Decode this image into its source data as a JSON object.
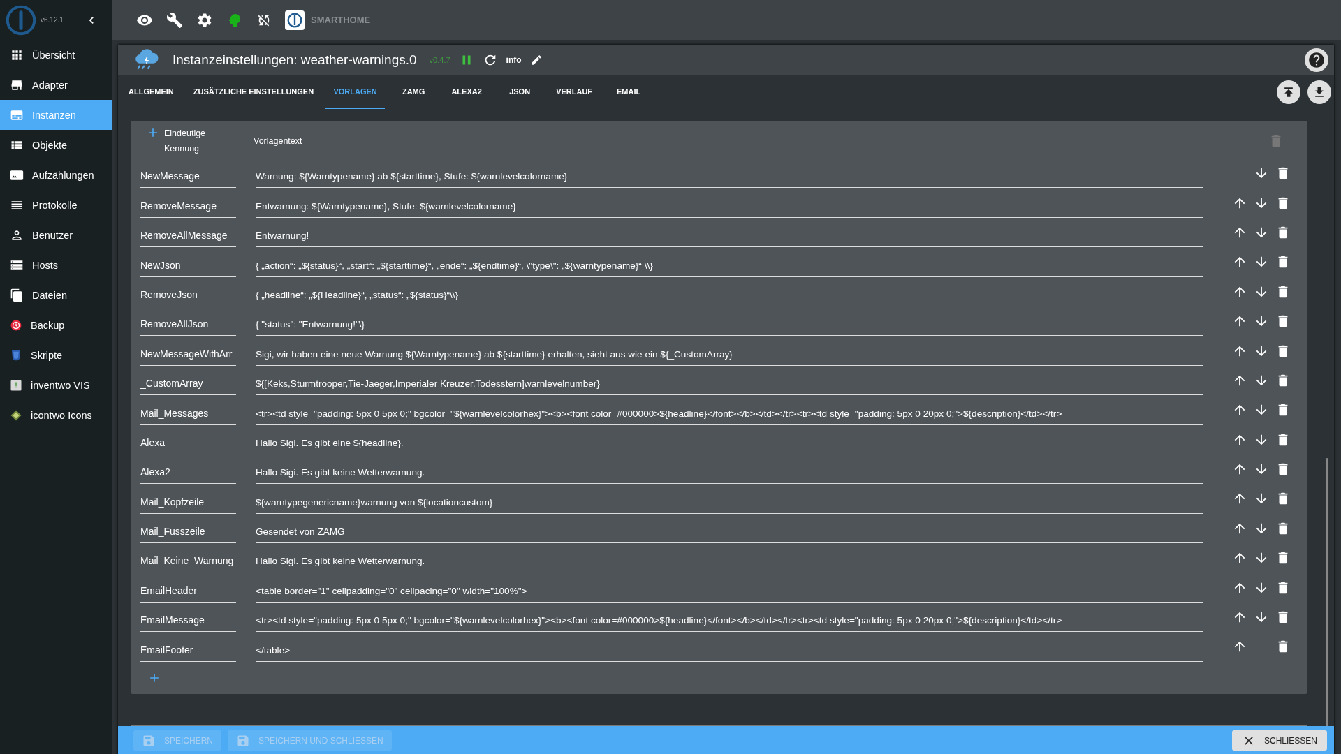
{
  "app": {
    "version": "v6.12.1",
    "host_label": "SMARTHOME"
  },
  "sidebar": {
    "items": [
      {
        "label": "Übersicht",
        "selected": false
      },
      {
        "label": "Adapter",
        "selected": false
      },
      {
        "label": "Instanzen",
        "selected": true
      },
      {
        "label": "Objekte",
        "selected": false
      },
      {
        "label": "Aufzählungen",
        "selected": false
      },
      {
        "label": "Protokolle",
        "selected": false
      },
      {
        "label": "Benutzer",
        "selected": false
      },
      {
        "label": "Hosts",
        "selected": false
      },
      {
        "label": "Dateien",
        "selected": false
      },
      {
        "label": "Backup",
        "selected": false
      },
      {
        "label": "Skripte",
        "selected": false
      },
      {
        "label": "inventwo VIS",
        "selected": false
      },
      {
        "label": "icontwo Icons",
        "selected": false
      }
    ]
  },
  "dialog": {
    "title": "Instanzeinstellungen: weather-warnings.0",
    "version": "v0.4.7",
    "info_label": "info",
    "tabs": [
      {
        "label": "ALLGEMEIN",
        "selected": false
      },
      {
        "label": "ZUSÄTZLICHE EINSTELLUNGEN",
        "selected": false
      },
      {
        "label": "VORLAGEN",
        "selected": true
      },
      {
        "label": "ZAMG",
        "selected": false
      },
      {
        "label": "ALEXA2",
        "selected": false
      },
      {
        "label": "JSON",
        "selected": false
      },
      {
        "label": "VERLAUF",
        "selected": false
      },
      {
        "label": "EMAIL",
        "selected": false
      }
    ],
    "table": {
      "columns": [
        "Eindeutige Kennung",
        "Vorlagentext"
      ],
      "rows": [
        {
          "key": "NewMessage",
          "value": "Warnung: ${Warntypename} ab ${starttime}, Stufe: ${warnlevelcolorname}",
          "can_move_up": false,
          "can_move_down": true
        },
        {
          "key": "RemoveMessage",
          "value": "Entwarnung: ${Warntypename}, Stufe: ${warnlevelcolorname}",
          "can_move_up": true,
          "can_move_down": true
        },
        {
          "key": "RemoveAllMessage",
          "value": "Entwarnung!",
          "can_move_up": true,
          "can_move_down": true
        },
        {
          "key": "NewJson",
          "value": "{ „action“: „${status}“, „start“: „${starttime}“, „ende“: „${endtime}“, \\\"type\\\": „${warntypename}“ \\\\}",
          "can_move_up": true,
          "can_move_down": true
        },
        {
          "key": "RemoveJson",
          "value": "{ „headline“: „${Headline}“, „status“: „${status}“\\\\}",
          "can_move_up": true,
          "can_move_down": true
        },
        {
          "key": "RemoveAllJson",
          "value": "{ \"status\": \"Entwarnung!\"\\}",
          "can_move_up": true,
          "can_move_down": true
        },
        {
          "key": "NewMessageWithArr",
          "value": "Sigi, wir haben eine neue Warnung ${Warntypename} ab ${starttime} erhalten, sieht aus wie ein ${_CustomArray}",
          "can_move_up": true,
          "can_move_down": true
        },
        {
          "key": "_CustomArray",
          "value": "${[Keks,Sturmtrooper,Tie-Jaeger,Imperialer Kreuzer,Todesstern]warnlevelnumber}",
          "can_move_up": true,
          "can_move_down": true
        },
        {
          "key": "Mail_Messages",
          "value": "<tr><td style=\"padding: 5px 0 5px 0;\" bgcolor=\"${warnlevelcolorhex}\"><b><font color=#000000>${headline}</font></b></td></tr><tr><td style=\"padding: 5px 0 20px 0;\">${description}</td></tr>",
          "can_move_up": true,
          "can_move_down": true
        },
        {
          "key": "Alexa",
          "value": "Hallo Sigi. Es gibt eine ${headline}.",
          "can_move_up": true,
          "can_move_down": true
        },
        {
          "key": "Alexa2",
          "value": "Hallo Sigi. Es gibt keine Wetterwarnung.",
          "can_move_up": true,
          "can_move_down": true
        },
        {
          "key": "Mail_Kopfzeile",
          "value": "${warntypegenericname}warnung von ${locationcustom}",
          "can_move_up": true,
          "can_move_down": true
        },
        {
          "key": "Mail_Fusszeile",
          "value": "Gesendet von ZAMG",
          "can_move_up": true,
          "can_move_down": true
        },
        {
          "key": "Mail_Keine_Warnung",
          "value": "Hallo Sigi. Es gibt keine Wetterwarnung.",
          "can_move_up": true,
          "can_move_down": true
        },
        {
          "key": "EmailHeader",
          "value": "<table border=\"1\" cellpadding=\"0\" cellpacing=\"0\" width=\"100%\">",
          "can_move_up": true,
          "can_move_down": true
        },
        {
          "key": "EmailMessage",
          "value": "<tr><td style=\"padding: 5px 0 5px 0;\" bgcolor=\"${warnlevelcolorhex}\"><b><font color=#000000>${headline}</font></b></td></tr><tr><td style=\"padding: 5px 0 20px 0;\">${description}</td></tr>",
          "can_move_up": true,
          "can_move_down": true
        },
        {
          "key": "EmailFooter",
          "value": "</table>",
          "can_move_up": true,
          "can_move_down": false
        }
      ]
    },
    "footer_buttons": [
      {
        "label": "SPEICHERN",
        "kind": "save",
        "disabled": true
      },
      {
        "label": "SPEICHERN UND SCHLIESSEN",
        "kind": "save",
        "disabled": true
      },
      {
        "label": "SCHLIESSEN",
        "kind": "close",
        "disabled": false
      }
    ]
  }
}
